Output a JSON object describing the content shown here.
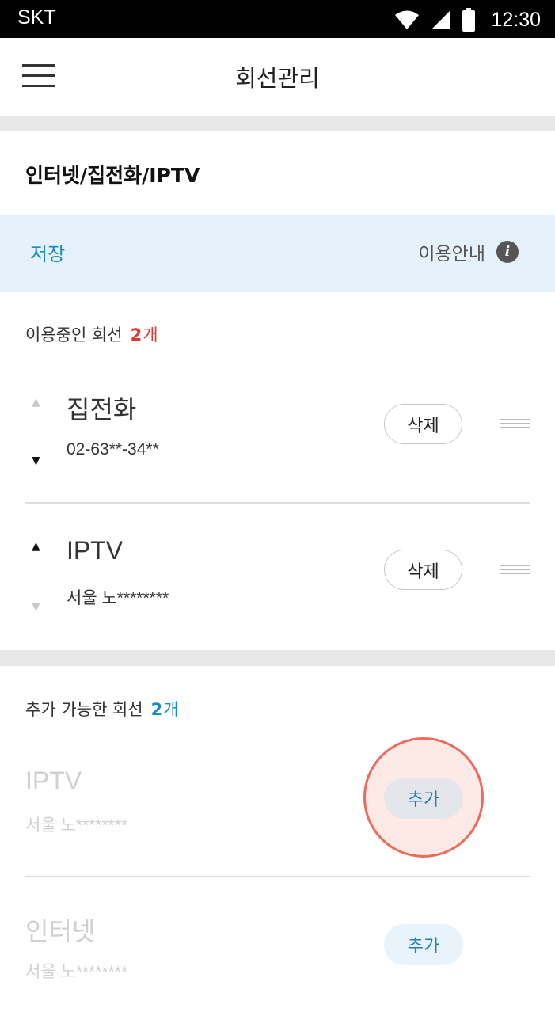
{
  "status_bar": {
    "carrier": "SKT",
    "time": "12:30",
    "icons": [
      "wifi-icon",
      "cell-signal-icon",
      "battery-icon"
    ]
  },
  "app_bar": {
    "title": "회선관리",
    "menu_icon": "hamburger-menu-icon"
  },
  "section": {
    "title": "인터넷/집전화/IPTV"
  },
  "action_bar": {
    "save_label": "저장",
    "guide_label": "이용안내",
    "guide_icon": "info-icon"
  },
  "in_use": {
    "label": "이용중인 회선",
    "count": "2",
    "unit": "개",
    "count_color": "#e0372f",
    "items": [
      {
        "name": "집전화",
        "sub": "02-63**-34**",
        "delete_label": "삭제"
      },
      {
        "name": "IPTV",
        "sub": "서울 노********",
        "delete_label": "삭제"
      }
    ]
  },
  "available": {
    "label": "추가 가능한 회선",
    "count": "2",
    "unit": "개",
    "count_color": "#1a8ac6",
    "items": [
      {
        "name": "IPTV",
        "sub": "서울 노********",
        "add_label": "추가"
      },
      {
        "name": "인터넷",
        "sub": "서울 노********",
        "add_label": "추가"
      }
    ]
  },
  "colors": {
    "accent_blue": "#1a8ac6",
    "accent_red": "#e0372f",
    "highlight_ring": "#ee6a5c"
  }
}
